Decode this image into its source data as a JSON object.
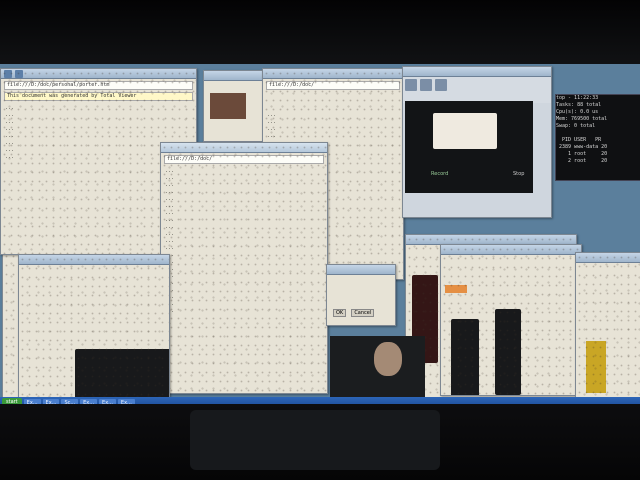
{
  "browser_main": {
    "address": "file:///D:/doc/personal/porter.htm",
    "info_bar": "This document was generated by Total Viewer",
    "body": "...\n...\n...\n...\n...\n...\n...\n..."
  },
  "browser_center": {
    "address": "file:///D:/doc/",
    "body": "...\n...\n...\n...\n...\n..."
  },
  "browser_mid": {
    "address": "file:///D:/doc/",
    "body": "...\n...\n...\n...\n...\n...\n...\n...\n...\n...\n...\n...\n...\n...\n...\n...\n...\n...\n...\n...\n..."
  },
  "webcam": {
    "label_left": "Record",
    "label_right": "Stop"
  },
  "terminal": {
    "lines": "top - 11:22:33\nTasks: 88 total\nCpu(s): 0.0 us\nMem: 769500 total\nSwap: 0 total\n\n  PID USER   PR\n 2389 www-data 20\n    1 root     20\n    2 root     20"
  },
  "dialog": {
    "ok": "OK",
    "cancel": "Cancel"
  },
  "taskbar": {
    "start": "start",
    "items": [
      "Ex...",
      "Ex...",
      "Sc...",
      "Ex...",
      "Ex...",
      "Ex..."
    ]
  }
}
